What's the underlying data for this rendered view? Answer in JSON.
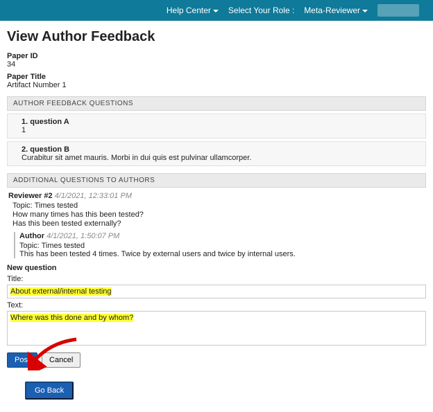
{
  "topbar": {
    "help": "Help Center",
    "role_label": "Select Your Role :",
    "role_value": "Meta-Reviewer"
  },
  "page_title": "View Author Feedback",
  "paper": {
    "id_label": "Paper ID",
    "id_value": "34",
    "title_label": "Paper Title",
    "title_value": "Artifact Number 1"
  },
  "sections": {
    "feedback_header": "AUTHOR FEEDBACK QUESTIONS",
    "additional_header": "ADDITIONAL QUESTIONS TO AUTHORS"
  },
  "questions": [
    {
      "q": "1. question A",
      "a": "1"
    },
    {
      "q": "2. question B",
      "a": "Curabitur sit amet mauris. Morbi in dui quis est pulvinar ullamcorper."
    }
  ],
  "thread": {
    "reviewer_label": "Reviewer #2",
    "reviewer_ts": "4/1/2021, 12:33:01 PM",
    "topic_label": "Topic:",
    "topic_value": "Times tested",
    "body_line1": "How many times has this been tested?",
    "body_line2": "Has this been tested externally?",
    "reply": {
      "author_label": "Author",
      "author_ts": "4/1/2021, 1:50:07 PM",
      "topic_value": "Times tested",
      "body": "This has been tested 4 times. Twice by external users and twice by internal users."
    }
  },
  "new_question": {
    "section_label": "New question",
    "title_label": "Title:",
    "title_value": "About external/internal testing",
    "text_label": "Text:",
    "text_value": "Where was this done and by whom?"
  },
  "buttons": {
    "post": "Post",
    "cancel": "Cancel",
    "go_back": "Go Back"
  }
}
